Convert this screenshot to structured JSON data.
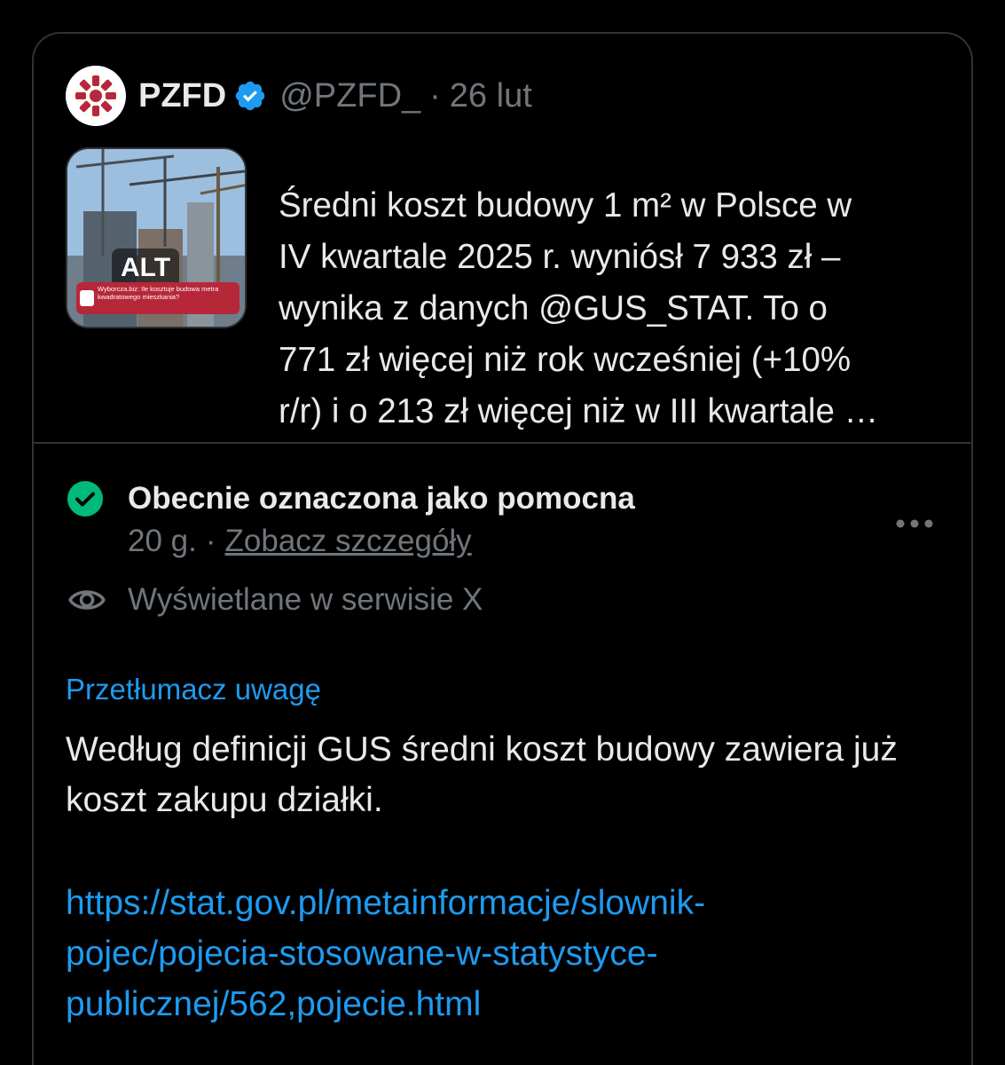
{
  "tweet": {
    "author_name": "PZFD",
    "handle": "@PZFD_",
    "separator": "·",
    "date": "26 lut",
    "text": "Średni koszt budowy 1 m² w Polsce w\nIV kwartale 2025 r. wyniósł 7 933 zł –\nwynika z danych @GUS_STAT. To o\n771 zł więcej niż rok wcześniej (+10%\nr/r) i o 213 zł więcej niż w III kwartale …",
    "thumbnail": {
      "alt_badge": "ALT",
      "card_text": "Wyborcza.biz: Ile kosztuje budowa metra kwadratowego mieszkania?"
    }
  },
  "note": {
    "status_title": "Obecnie oznaczona jako pomocna",
    "age": "20 g.",
    "separator": "·",
    "details_link": "Zobacz szczegóły",
    "visibility_text": "Wyświetlane w serwisie X",
    "translate_label": "Przetłumacz uwagę",
    "body": "Według definicji GUS średni koszt budowy zawiera już koszt zakupu działki.",
    "link": "https://stat.gov.pl/metainformacje/slownik-\npojec/pojecia-stosowane-w-statystyce-\npublicznej/562,pojecie.html"
  },
  "colors": {
    "background": "#000000",
    "text_primary": "#e7e9ea",
    "text_secondary": "#71767b",
    "link": "#1d9bf0",
    "helpful_green": "#00ba7c",
    "brand_red": "#b7273a",
    "border": "#2f3336"
  },
  "icons": {
    "verified": "verified-badge-icon",
    "helpful": "check-circle-icon",
    "more": "more-horizontal-icon",
    "visibility": "eye-icon"
  }
}
